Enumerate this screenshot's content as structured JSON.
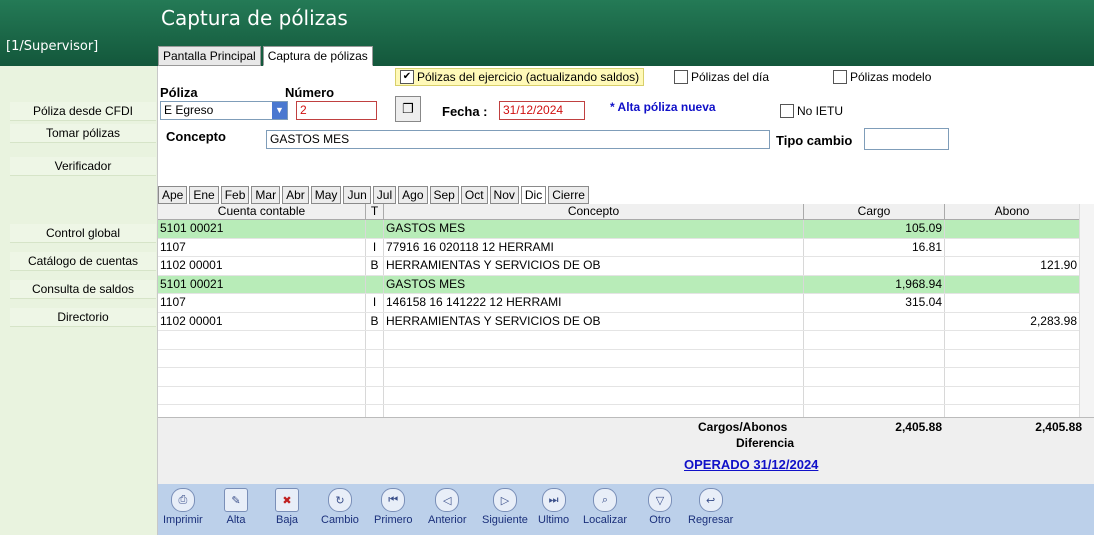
{
  "app": {
    "title": "Captura de pólizas",
    "user": "[1/Supervisor]"
  },
  "top_tabs": [
    "Pantalla Principal",
    "Captura de pólizas"
  ],
  "sidebar": {
    "items": [
      "Póliza desde CFDI",
      "Tomar pólizas",
      "Verificador",
      "Control global",
      "Catálogo de cuentas",
      "Consulta de saldos",
      "Directorio"
    ]
  },
  "options": {
    "ejercicio": {
      "label": "Pólizas del ejercicio (actualizando saldos)",
      "checked": "✔"
    },
    "dia": {
      "label": "Pólizas del día"
    },
    "modelo": {
      "label": "Pólizas modelo"
    },
    "no_ietu": {
      "label": "No IETU"
    }
  },
  "form": {
    "poliza_label": "Póliza",
    "poliza_value": "E Egreso",
    "numero_label": "Número",
    "numero_value": "2",
    "fecha_label": "Fecha :",
    "fecha_value": "31/12/2024",
    "alta_note": "* Alta póliza nueva",
    "concepto_label": "Concepto",
    "concepto_value": "GASTOS MES",
    "tipo_cambio_label": "Tipo cambio",
    "tipo_cambio_value": ""
  },
  "months": [
    "Ape",
    "Ene",
    "Feb",
    "Mar",
    "Abr",
    "May",
    "Jun",
    "Jul",
    "Ago",
    "Sep",
    "Oct",
    "Nov",
    "Dic",
    "Cierre"
  ],
  "grid": {
    "headers": [
      "Cuenta contable",
      "T",
      "Concepto",
      "Cargo",
      "Abono"
    ],
    "rows": [
      {
        "cuenta": "5101 00021",
        "t": "",
        "concepto": "GASTOS MES",
        "cargo": "105.09",
        "abono": ""
      },
      {
        "cuenta": "1107",
        "t": "I",
        "concepto": "77916  16 020118 12   HERRAMI",
        "cargo": "16.81",
        "abono": ""
      },
      {
        "cuenta": "1102 00001",
        "t": "B",
        "concepto": "HERRAMIENTAS Y SERVICIOS DE OB",
        "cargo": "",
        "abono": "121.90"
      },
      {
        "cuenta": "5101 00021",
        "t": "",
        "concepto": "GASTOS MES",
        "cargo": "1,968.94",
        "abono": ""
      },
      {
        "cuenta": "1107",
        "t": "I",
        "concepto": "146158 16 141222 12   HERRAMI",
        "cargo": "315.04",
        "abono": ""
      },
      {
        "cuenta": "1102 00001",
        "t": "B",
        "concepto": "HERRAMIENTAS Y SERVICIOS DE OB",
        "cargo": "",
        "abono": "2,283.98"
      }
    ]
  },
  "totals": {
    "label_cargos_abonos": "Cargos/Abonos",
    "label_diferencia": "Diferencia",
    "total_cargo": "2,405.88",
    "total_abono": "2,405.88",
    "operado": "OPERADO 31/12/2024"
  },
  "toolbar": [
    "Imprimir",
    "Alta",
    "Baja",
    "Cambio",
    "Primero",
    "Anterior",
    "Siguiente",
    "Ultimo",
    "Localizar",
    "Otro",
    "Regresar"
  ],
  "colors": {
    "banner": "#1b6b4a",
    "highlight_row": "#b8ecb8",
    "link": "#1010c8"
  }
}
